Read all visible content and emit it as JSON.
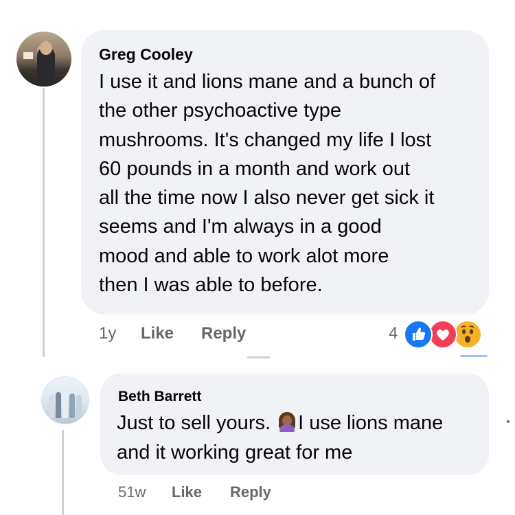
{
  "comments": [
    {
      "author": "Greg Cooley",
      "text_lines": [
        "I use it and lions mane and a bunch of",
        "the other psychoactive type",
        "mushrooms. It's changed my life I lost",
        "60 pounds in a month and work out",
        "all the time now I also never get sick it",
        "seems and I'm always in a good",
        "mood and able to work alot more",
        "then I was able to before."
      ],
      "time": "1y",
      "like_label": "Like",
      "reply_label": "Reply",
      "reaction_count": "4",
      "reactions": [
        "like-icon",
        "love-icon",
        "wow-icon"
      ]
    },
    {
      "author": "Beth Barrett",
      "text_line1_before": "Just to sell yours.",
      "text_line1_after": "I use lions mane",
      "text_line2": "and it working great for me",
      "emoji": "woman-facepalming-emoji",
      "time": "51w",
      "like_label": "Like",
      "reply_label": "Reply"
    }
  ],
  "colors": {
    "bubble_bg": "#f0f2f5",
    "meta_text": "#65676b",
    "like_blue": "#1877f2",
    "love_red": "#f33e58",
    "wow_yellow": "#f7b125"
  }
}
